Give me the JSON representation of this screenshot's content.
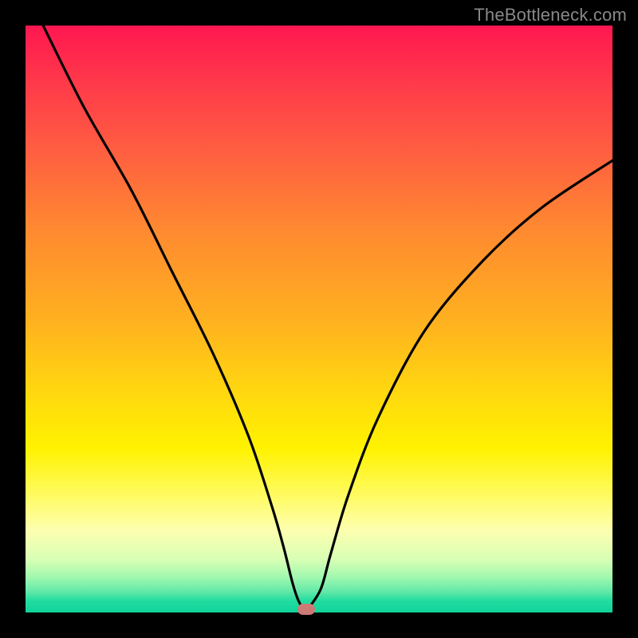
{
  "watermark": "TheBottleneck.com",
  "chart_data": {
    "type": "line",
    "title": "",
    "xlabel": "",
    "ylabel": "",
    "xlim": [
      0,
      100
    ],
    "ylim": [
      0,
      100
    ],
    "background_gradient": {
      "top_color": "#ff1750",
      "bottom_color": "#10d49a",
      "meaning": "red=high bottleneck, green=low bottleneck"
    },
    "series": [
      {
        "name": "bottleneck-curve",
        "x": [
          3,
          10,
          18,
          25,
          32,
          38,
          42,
          44,
          45.5,
          46.5,
          47.5,
          48,
          50.3,
          52,
          55,
          60,
          68,
          78,
          88,
          100
        ],
        "y": [
          100,
          86,
          72,
          58,
          44,
          30,
          18,
          11,
          5,
          2,
          0.5,
          0.5,
          4,
          10,
          20,
          33,
          48,
          60,
          69,
          77
        ]
      }
    ],
    "marker": {
      "name": "optimal-point",
      "x": 47.8,
      "y": 0.5,
      "color": "#cd7a76"
    }
  }
}
